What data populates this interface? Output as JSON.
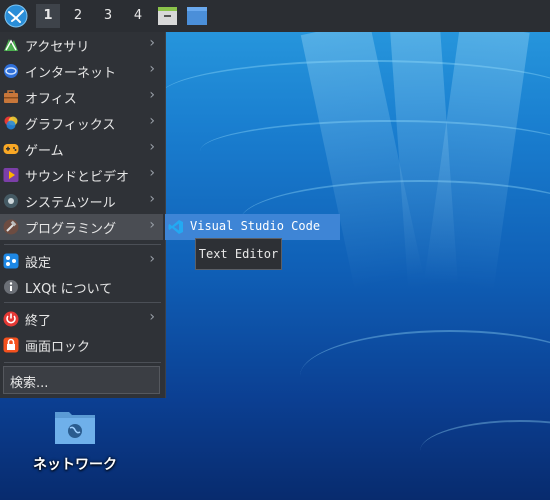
{
  "taskbar": {
    "workspaces": [
      "1",
      "2",
      "3",
      "4"
    ],
    "active_workspace": "1",
    "icons": [
      "lxqt-start-icon",
      "archive-icon",
      "window-icon"
    ]
  },
  "menu": {
    "items": [
      {
        "label": "アクセサリ",
        "icon": "accessories-icon",
        "has_submenu": true
      },
      {
        "label": "インターネット",
        "icon": "internet-icon",
        "has_submenu": true
      },
      {
        "label": "オフィス",
        "icon": "office-icon",
        "has_submenu": true
      },
      {
        "label": "グラフィックス",
        "icon": "graphics-icon",
        "has_submenu": true
      },
      {
        "label": "ゲーム",
        "icon": "games-icon",
        "has_submenu": true
      },
      {
        "label": "サウンドとビデオ",
        "icon": "multimedia-icon",
        "has_submenu": true
      },
      {
        "label": "システムツール",
        "icon": "system-tools-icon",
        "has_submenu": true
      },
      {
        "label": "プログラミング",
        "icon": "programming-icon",
        "has_submenu": true,
        "highlighted": true
      },
      {
        "label": "設定",
        "icon": "settings-icon",
        "has_submenu": true
      },
      {
        "label": "LXQt について",
        "icon": "info-icon",
        "has_submenu": false
      },
      {
        "label": "終了",
        "icon": "power-icon",
        "has_submenu": true
      },
      {
        "label": "画面ロック",
        "icon": "lock-icon",
        "has_submenu": false
      }
    ],
    "arrow": "›",
    "search_placeholder": "検索..."
  },
  "submenu": {
    "items": [
      {
        "label": "Visual Studio Code",
        "icon": "vscode-icon"
      }
    ]
  },
  "tooltip": {
    "text": "Text Editor"
  },
  "desktop": {
    "icons": [
      {
        "label": "ネットワーク",
        "icon": "network-folder-icon"
      }
    ]
  },
  "colors": {
    "taskbar_bg": "#2b2e33",
    "menu_bg": "#2f3237",
    "highlight": "#3e85d6"
  }
}
